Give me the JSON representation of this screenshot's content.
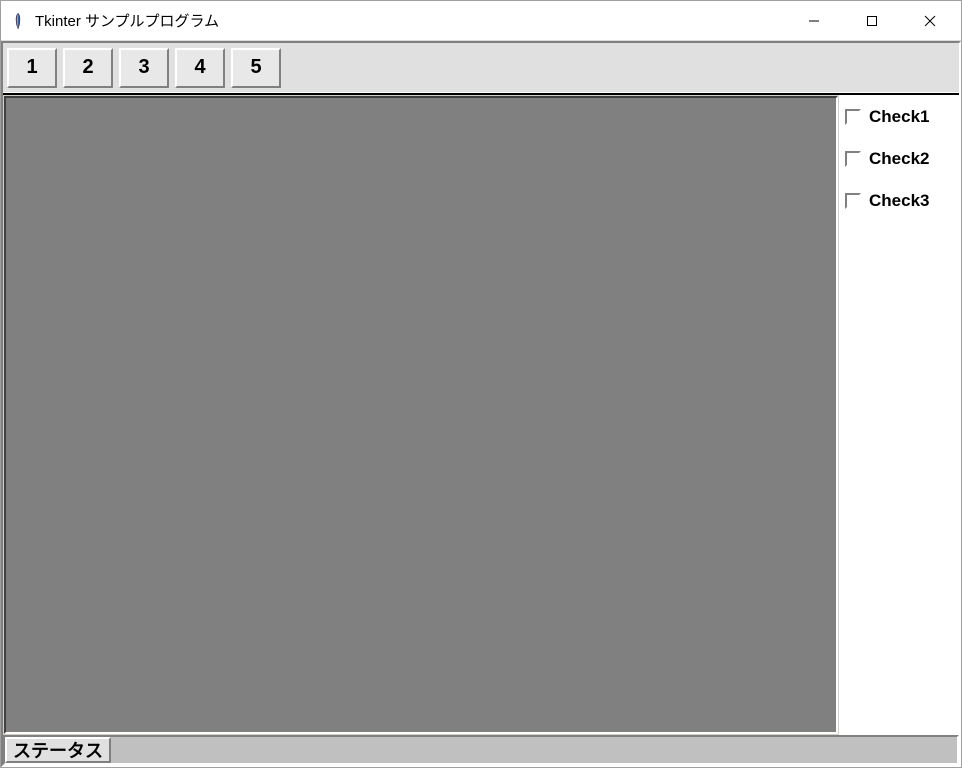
{
  "window": {
    "title": "Tkinter サンプルプログラム"
  },
  "toolbar": {
    "buttons": [
      {
        "label": "1"
      },
      {
        "label": "2"
      },
      {
        "label": "3"
      },
      {
        "label": "4"
      },
      {
        "label": "5"
      }
    ]
  },
  "sidepanel": {
    "checks": [
      {
        "label": "Check1",
        "checked": false
      },
      {
        "label": "Check2",
        "checked": false
      },
      {
        "label": "Check3",
        "checked": false
      }
    ]
  },
  "statusbar": {
    "text": "ステータス"
  }
}
